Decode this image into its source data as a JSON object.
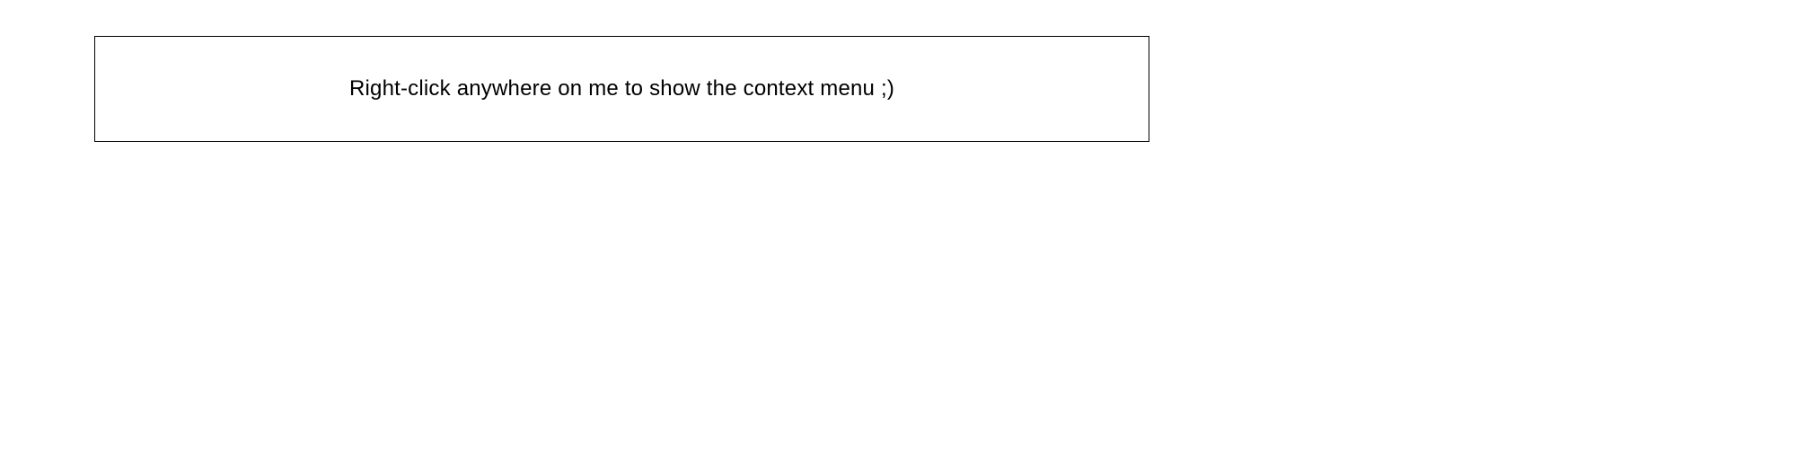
{
  "main": {
    "context_box_text": "Right-click anywhere on me to show the context menu ;)"
  }
}
